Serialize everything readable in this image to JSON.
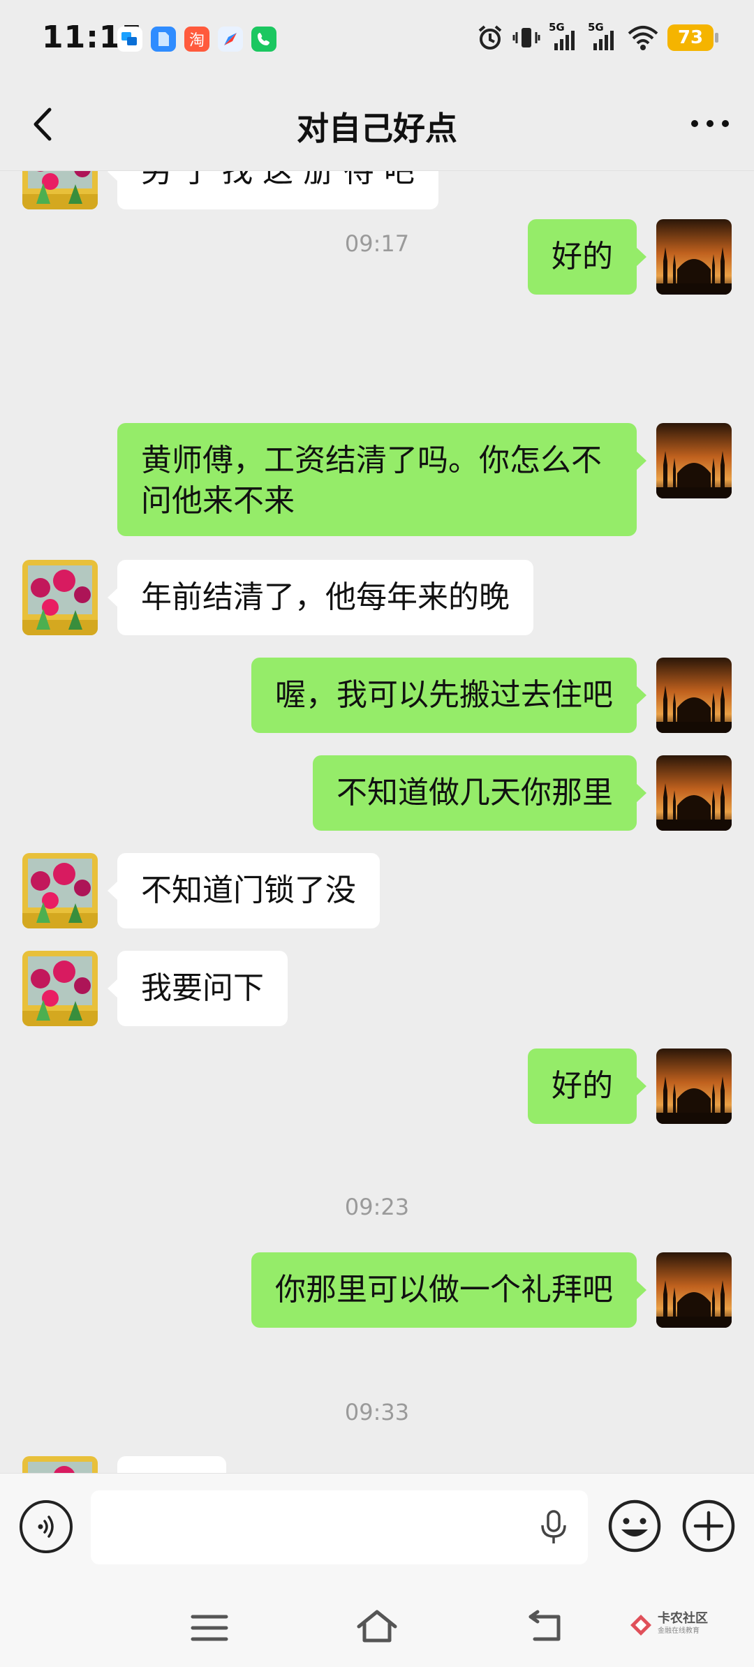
{
  "status_bar": {
    "time": "11:15",
    "app_icons": [
      "message-app-icon",
      "files-app-icon",
      "taobao-app-icon",
      "browser-app-icon",
      "phone-app-icon"
    ],
    "taobao_glyph": "淘",
    "network_1": "5G",
    "network_2": "5G",
    "battery": "73"
  },
  "header": {
    "title": "对自己好点"
  },
  "messages": [
    {
      "side": "in",
      "text": "另 了 找 这 册 待 吧"
    },
    {
      "side": "out",
      "text": "好的"
    },
    {
      "type": "time",
      "text": "09:17"
    },
    {
      "side": "out",
      "text": "黄师傅，工资结清了吗。你怎么不问他来不来"
    },
    {
      "side": "in",
      "text": "年前结清了，他每年来的晚"
    },
    {
      "side": "out",
      "text": "喔，我可以先搬过去住吧"
    },
    {
      "side": "out",
      "text": "不知道做几天你那里"
    },
    {
      "side": "in",
      "text": "不知道门锁了没"
    },
    {
      "side": "in",
      "text": "我要问下"
    },
    {
      "side": "out",
      "text": "好的"
    },
    {
      "type": "time",
      "text": "09:23"
    },
    {
      "side": "out",
      "text": "你那里可以做一个礼拜吧"
    },
    {
      "type": "time",
      "text": "09:33"
    }
  ],
  "input": {
    "placeholder": ""
  },
  "watermark": {
    "main": "卡农社区",
    "sub": "金融在线教育"
  },
  "colors": {
    "background": "#ededed",
    "outgoing_bubble": "#95ec69",
    "incoming_bubble": "#ffffff",
    "battery": "#f5b400"
  }
}
